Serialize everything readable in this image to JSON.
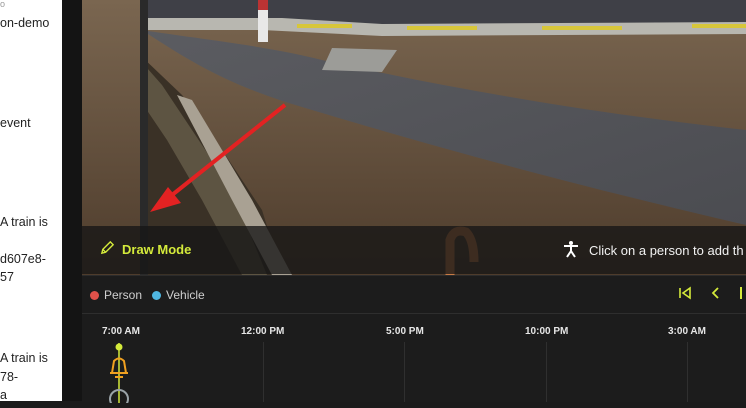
{
  "left_panel": {
    "lines": [
      "o",
      "on-demo",
      "event",
      "A train is",
      "d607e8-",
      "57",
      "A train is",
      "78-",
      "a"
    ]
  },
  "overlay": {
    "draw_mode_label": "Draw Mode",
    "hint": "Click on a person to add th"
  },
  "timeline": {
    "legend": [
      {
        "label": "Person",
        "color": "#e0514a"
      },
      {
        "label": "Vehicle",
        "color": "#4fb6e0"
      }
    ],
    "ticks": [
      "7:00 AM",
      "12:00 PM",
      "5:00 PM",
      "10:00 PM",
      "3:00 AM"
    ]
  },
  "colors": {
    "accent": "#d4ea3b",
    "annotation_arrow": "#e32222",
    "event_marker": "#f0a020"
  },
  "icons": [
    "pencil-icon",
    "person-icon",
    "skip-to-start-icon",
    "chevron-left-icon",
    "play-icon"
  ]
}
